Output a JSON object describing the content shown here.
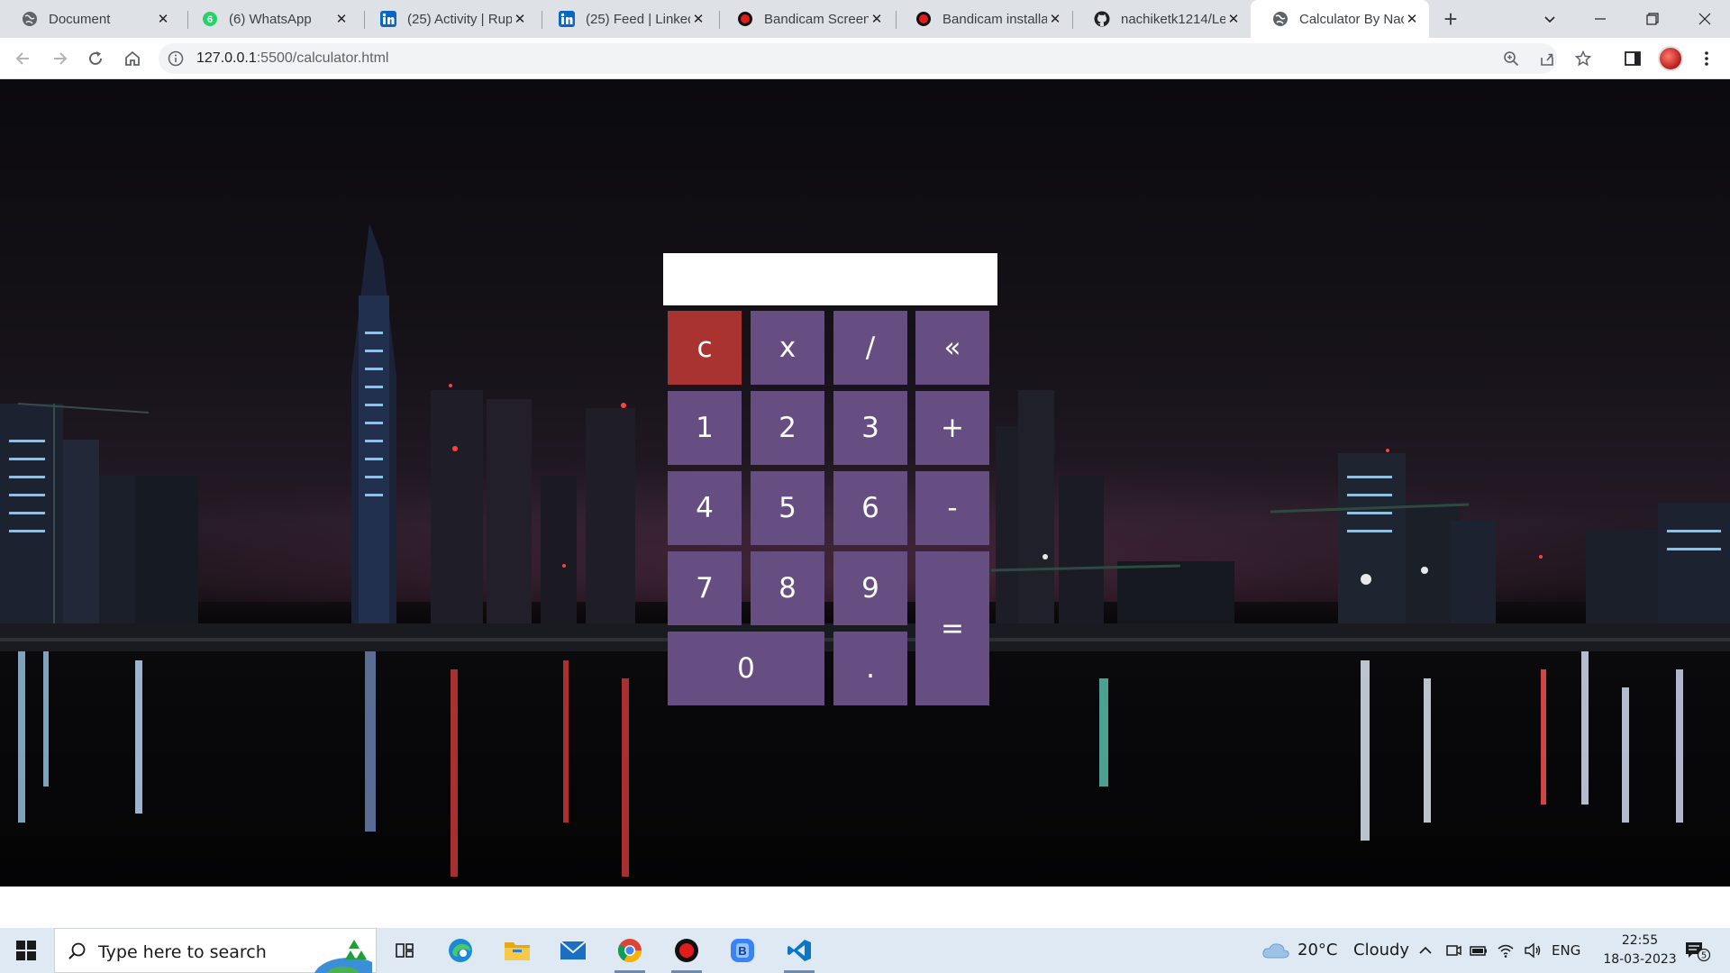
{
  "browser": {
    "tabs": [
      {
        "title": "Document",
        "favicon": "globe-icon"
      },
      {
        "title": "(6) WhatsApp",
        "favicon": "whatsapp-icon",
        "badge": "6"
      },
      {
        "title": "(25) Activity | Rup",
        "favicon": "linkedin-icon"
      },
      {
        "title": "(25) Feed | Linked",
        "favicon": "linkedin-icon"
      },
      {
        "title": "Bandicam Screen",
        "favicon": "bandicam-icon"
      },
      {
        "title": "Bandicam installa",
        "favicon": "bandicam-icon"
      },
      {
        "title": "nachiketk1214/Le",
        "favicon": "github-icon"
      },
      {
        "title": "Calculator By Nac",
        "favicon": "globe-icon",
        "active": true
      }
    ],
    "new_tab_label": "+",
    "url_host": "127.0.0.1",
    "url_rest": ":5500/calculator.html"
  },
  "calculator": {
    "display_value": "",
    "keys": [
      {
        "label": "c",
        "role": "clear"
      },
      {
        "label": "x",
        "role": "operator"
      },
      {
        "label": "/",
        "role": "operator"
      },
      {
        "label": "«",
        "role": "backspace"
      },
      {
        "label": "1",
        "role": "digit"
      },
      {
        "label": "2",
        "role": "digit"
      },
      {
        "label": "3",
        "role": "digit"
      },
      {
        "label": "+",
        "role": "operator"
      },
      {
        "label": "4",
        "role": "digit"
      },
      {
        "label": "5",
        "role": "digit"
      },
      {
        "label": "6",
        "role": "digit"
      },
      {
        "label": "-",
        "role": "operator"
      },
      {
        "label": "7",
        "role": "digit"
      },
      {
        "label": "8",
        "role": "digit"
      },
      {
        "label": "9",
        "role": "digit"
      },
      {
        "label": "=",
        "role": "equals"
      },
      {
        "label": "0",
        "role": "digit"
      },
      {
        "label": ".",
        "role": "decimal"
      }
    ],
    "colors": {
      "key": "#674e82",
      "clear": "#a83331",
      "display": "#ffffff"
    }
  },
  "taskbar": {
    "search_placeholder": "Type here to search",
    "weather_temp": "20°C",
    "weather_text": "Cloudy",
    "language": "ENG",
    "time": "22:55",
    "date": "18-03-2023",
    "notification_count": "5",
    "apps": [
      "task-view-icon",
      "edge-icon",
      "file-explorer-icon",
      "mail-icon",
      "chrome-icon",
      "bandicam-icon",
      "bandicam-app-icon",
      "vscode-icon"
    ]
  }
}
